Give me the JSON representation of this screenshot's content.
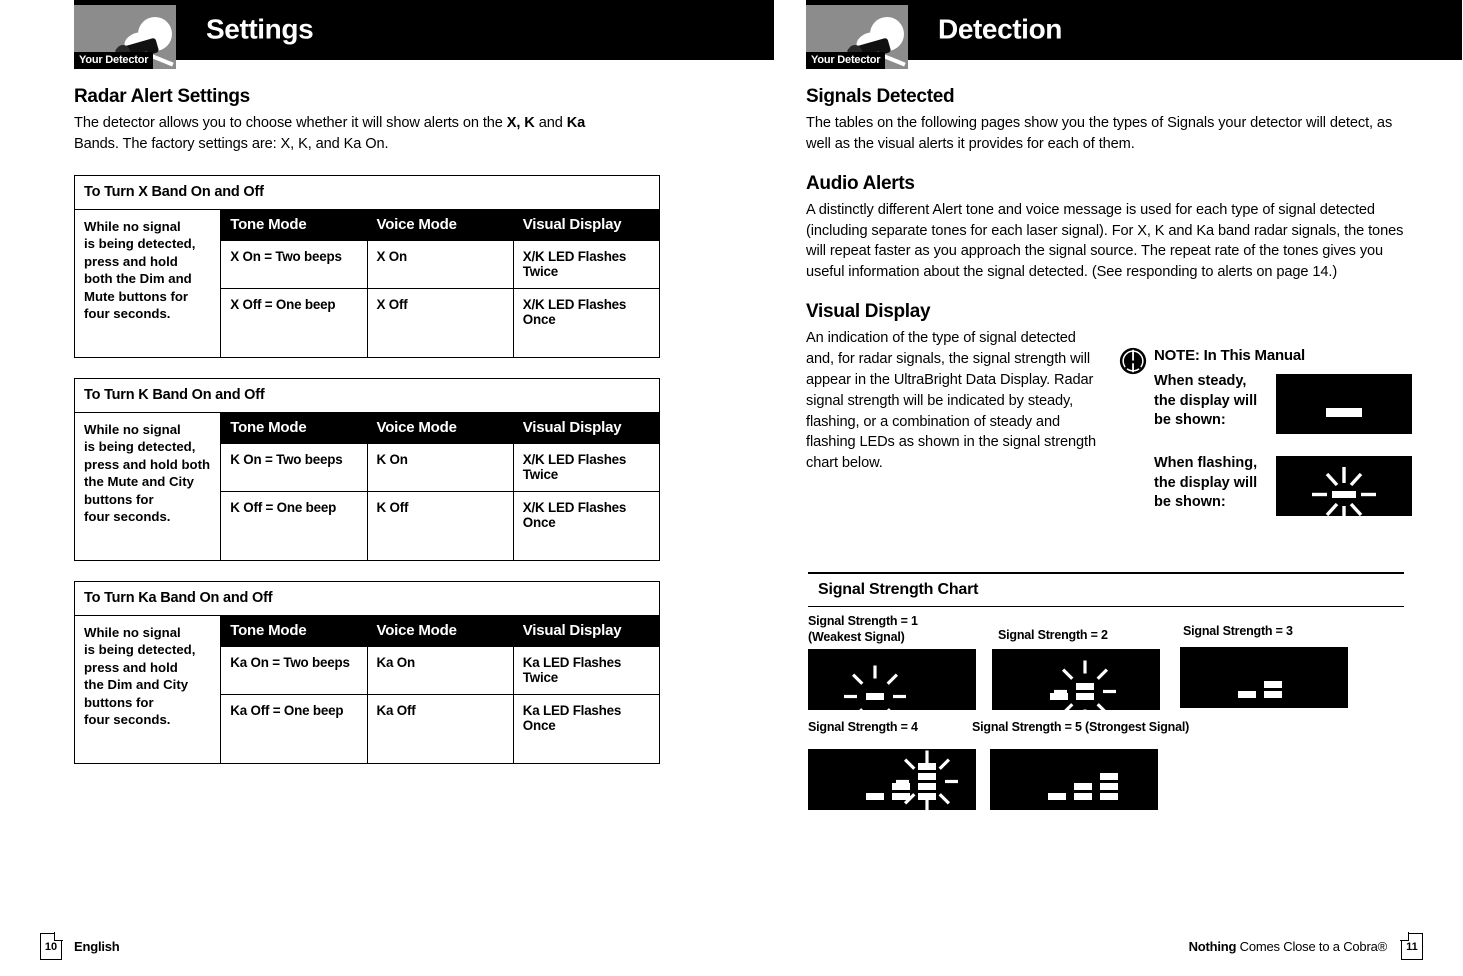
{
  "left_page": {
    "header": {
      "title": "Settings",
      "badge_caption": "Your Detector"
    },
    "section_title": "Radar Alert Settings",
    "intro_1": "The detector allows you to choose whether it will show alerts on the ",
    "intro_bold_1": "X, K",
    "intro_2": " and ",
    "intro_bold_2": "Ka",
    "intro_3": "Bands. The factory settings are: X, K, and Ka On.",
    "tables": [
      {
        "caption": "To Turn X Band On and Off",
        "side_lines": [
          "While no signal",
          "is being detected,",
          "press and hold",
          "both the Dim and",
          "Mute buttons for",
          "four seconds."
        ],
        "headers": [
          "Tone Mode",
          "Voice Mode",
          "Visual Display"
        ],
        "rows": [
          [
            "X On = Two beeps",
            "X On",
            "X/K LED Flashes Twice"
          ],
          [
            "X Off = One beep",
            "X Off",
            "X/K LED Flashes Once"
          ]
        ]
      },
      {
        "caption": "To Turn K Band On and Off",
        "side_lines": [
          "While no signal",
          "is being detected,",
          "press and hold both",
          "the Mute and City",
          "buttons for",
          "four seconds."
        ],
        "headers": [
          "Tone Mode",
          "Voice Mode",
          "Visual Display"
        ],
        "rows": [
          [
            "K On = Two beeps",
            "K On",
            "X/K LED Flashes Twice"
          ],
          [
            "K Off = One beep",
            "K Off",
            "X/K LED Flashes Once"
          ]
        ]
      },
      {
        "caption": "To Turn Ka Band On and Off",
        "side_lines": [
          "While no signal",
          "is being detected,",
          "press and hold",
          "the Dim and City",
          "buttons for",
          "four seconds."
        ],
        "headers": [
          "Tone Mode",
          "Voice Mode",
          "Visual Display"
        ],
        "rows": [
          [
            "Ka On = Two beeps",
            "Ka On",
            "Ka LED Flashes Twice"
          ],
          [
            "Ka Off = One beep",
            "Ka Off",
            "Ka LED Flashes Once"
          ]
        ]
      }
    ],
    "footer": {
      "page_number": "10",
      "label": "English"
    }
  },
  "right_page": {
    "header": {
      "title": "Detection",
      "badge_caption": "Your Detector"
    },
    "signals_detected": {
      "title": "Signals Detected",
      "body": "The tables on the following pages show you the types of Signals your detector will detect, as well as the visual alerts it provides for each of them."
    },
    "audio_alerts": {
      "title": "Audio Alerts",
      "body": "A distinctly different Alert tone and voice message is used for each type of signal detected (including separate tones for each laser signal). For X, K and Ka band radar signals, the tones will repeat faster as you approach the signal source. The repeat rate of the tones gives you useful information about the signal detected. (See responding to alerts on page 14.)"
    },
    "visual_display": {
      "title": "Visual Display",
      "body": "An indication of the type of signal detected and, for radar signals, the signal strength will appear in the UltraBright Data Display. Radar signal strength will be indicated by steady, flashing, or a combination of steady and flashing LEDs as shown in the signal strength chart below."
    },
    "note": {
      "title": "NOTE: In This Manual",
      "steady_label": "When steady,\nthe display will\nbe shown:",
      "flashing_label": "When flashing,\nthe display will\nbe shown:"
    },
    "footer": {
      "page_number": "11",
      "tagline_bold": "Nothing",
      "tagline_rest": " Comes Close to a Cobra®"
    }
  },
  "chart_data": {
    "type": "table",
    "title": "Signal Strength Chart",
    "items": [
      {
        "label": "Signal Strength = 1\n(Weakest Signal)",
        "level": 1,
        "steady_bars": 0,
        "flashing_bar_segments": 1,
        "flashing": true
      },
      {
        "label": "Signal Strength = 2",
        "level": 2,
        "steady_bars": 1,
        "flashing_bar_segments": 2,
        "flashing": true
      },
      {
        "label": "Signal Strength = 3",
        "level": 3,
        "steady_bars": 2,
        "flashing_bar_segments": 0,
        "flashing": false
      },
      {
        "label": "Signal Strength = 4",
        "level": 4,
        "steady_bars": 2,
        "flashing_bar_segments": 4,
        "flashing": true
      },
      {
        "label": "Signal Strength = 5 (Strongest Signal)",
        "level": 5,
        "steady_bars": 3,
        "flashing_bar_segments": 0,
        "flashing": false
      }
    ]
  },
  "colors": {
    "ink": "#000000",
    "paper": "#ffffff",
    "badge_gray": "#8c8c8c",
    "lcd": "#000000",
    "lcd_led": "#ffffff"
  }
}
